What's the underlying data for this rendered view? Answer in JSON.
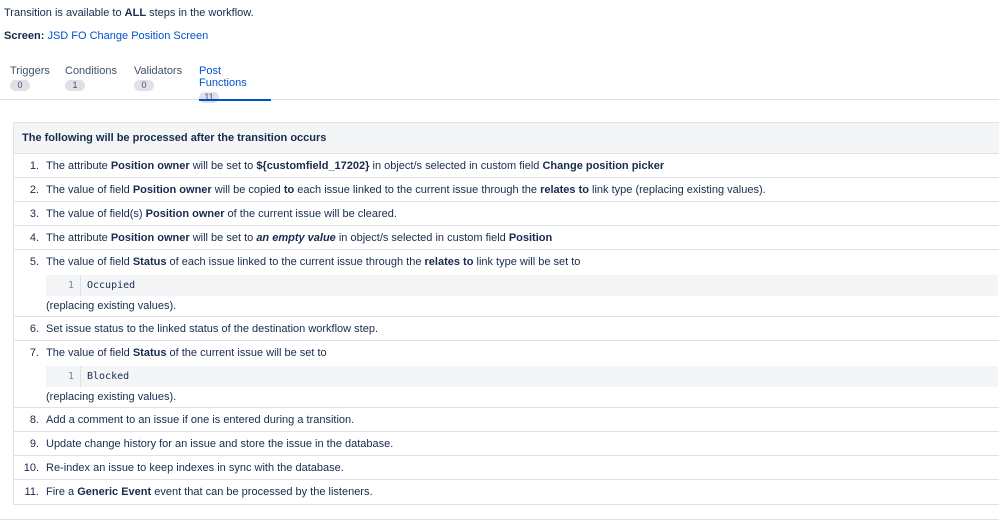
{
  "intro": {
    "prefix": "Transition is available to ",
    "bold": "ALL",
    "suffix": " steps in the workflow."
  },
  "screen": {
    "label": "Screen",
    "value": "JSD FO Change Position Screen"
  },
  "tabs": [
    {
      "label": "Triggers",
      "count": "0"
    },
    {
      "label": "Conditions",
      "count": "1"
    },
    {
      "label": "Validators",
      "count": "0"
    },
    {
      "label": "Post Functions",
      "count": "11"
    }
  ],
  "panel": {
    "header": "The following will be processed after the transition occurs"
  },
  "items": {
    "i1": {
      "num": "1.",
      "a": "The attribute ",
      "b1": "Position owner",
      "c": " will be set to ",
      "b2": "${customfield_17202}",
      "d": " in object/s selected in custom field ",
      "b3": "Change position picker"
    },
    "i2": {
      "num": "2.",
      "a": "The value of field ",
      "b1": "Position owner",
      "c": " will be copied ",
      "b2": "to",
      "d": " each issue linked to the current issue through the ",
      "b3": "relates to",
      "e": " link type (replacing existing values)."
    },
    "i3": {
      "num": "3.",
      "a": "The value of field(s) ",
      "b1": "Position owner",
      "c": " of the current issue will be cleared."
    },
    "i4": {
      "num": "4.",
      "a": "The attribute ",
      "b1": "Position owner",
      "c": " will be set to ",
      "b2": "an empty value",
      "d": " in object/s selected in custom field ",
      "b3": "Position"
    },
    "i5": {
      "num": "5.",
      "a": "The value of field ",
      "b1": "Status",
      "c": " of each issue linked to the current issue through the ",
      "b2": "relates to",
      "d": " link type will be set to",
      "line": "1",
      "code": "Occupied",
      "after": "(replacing existing values)."
    },
    "i6": {
      "num": "6.",
      "a": "Set issue status to the linked status of the destination workflow step."
    },
    "i7": {
      "num": "7.",
      "a": "The value of field ",
      "b1": "Status",
      "c": " of the current issue will be set to",
      "line": "1",
      "code": "Blocked",
      "after": "(replacing existing values)."
    },
    "i8": {
      "num": "8.",
      "a": "Add a comment to an issue if one is entered during a transition."
    },
    "i9": {
      "num": "9.",
      "a": "Update change history for an issue and store the issue in the database."
    },
    "i10": {
      "num": "10.",
      "a": "Re-index an issue to keep indexes in sync with the database."
    },
    "i11": {
      "num": "11.",
      "a": "Fire a ",
      "b1": "Generic Event",
      "c": " event that can be processed by the listeners."
    }
  }
}
